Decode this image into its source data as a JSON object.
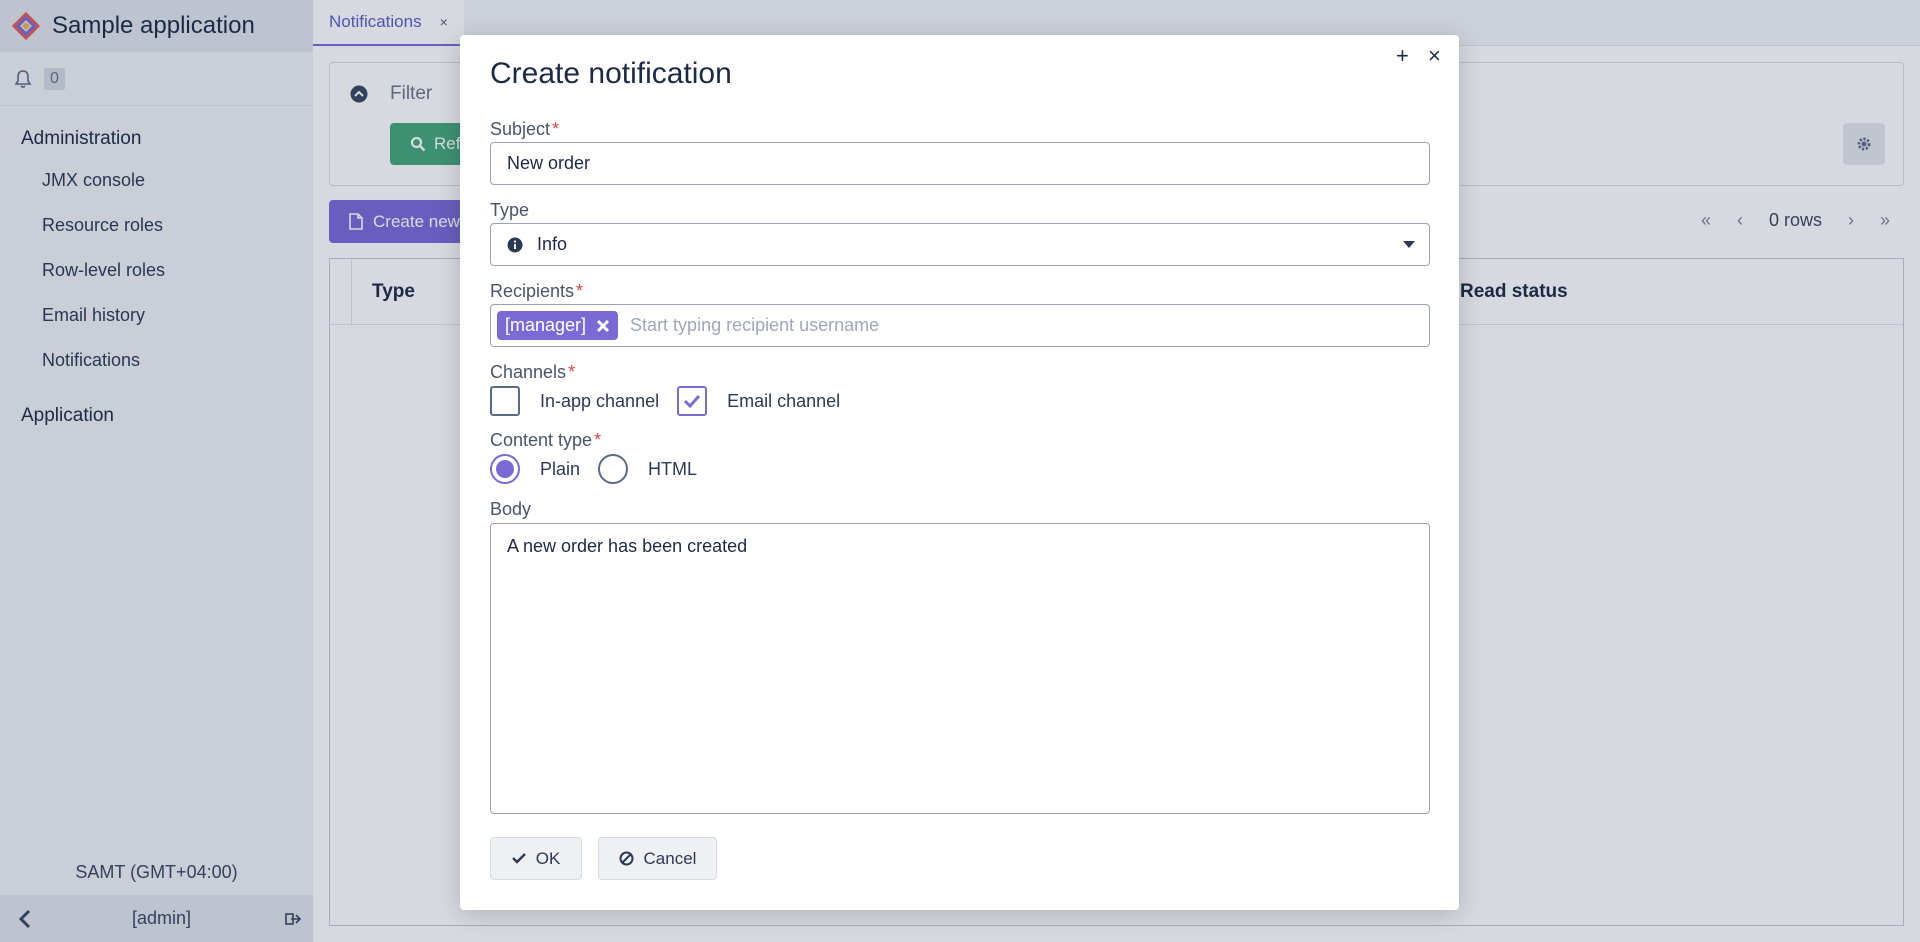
{
  "app": {
    "title": "Sample application",
    "notifications_count": "0",
    "timezone": "SAMT (GMT+04:00)",
    "user": "[admin]"
  },
  "sidebar": {
    "groups": [
      {
        "label": "Administration",
        "items": [
          {
            "label": "JMX console"
          },
          {
            "label": "Resource roles"
          },
          {
            "label": "Row-level roles"
          },
          {
            "label": "Email history"
          },
          {
            "label": "Notifications"
          }
        ]
      },
      {
        "label": "Application",
        "items": []
      }
    ]
  },
  "tabs": [
    {
      "label": "Notifications",
      "close": "×"
    }
  ],
  "filter": {
    "label": "Filter",
    "refresh_label": "Ref"
  },
  "toolbar": {
    "create_label": "Create new"
  },
  "pager": {
    "first": "«",
    "prev": "‹",
    "rows": "0 rows",
    "next": "›",
    "last": "»"
  },
  "grid": {
    "columns": [
      "Type",
      "Read status"
    ]
  },
  "dialog": {
    "title": "Create notification",
    "maximize": "+",
    "close": "×",
    "subject": {
      "label": "Subject",
      "value": "New order"
    },
    "type": {
      "label": "Type",
      "value": "Info"
    },
    "recipients": {
      "label": "Recipients",
      "tokens": [
        "[manager]"
      ],
      "placeholder": "Start typing recipient username"
    },
    "channels": {
      "label": "Channels",
      "options": [
        {
          "label": "In-app channel",
          "checked": false
        },
        {
          "label": "Email channel",
          "checked": true
        }
      ]
    },
    "content_type": {
      "label": "Content type",
      "options": [
        {
          "label": "Plain",
          "selected": true
        },
        {
          "label": "HTML",
          "selected": false
        }
      ]
    },
    "body": {
      "label": "Body",
      "value": "A new order has been created"
    },
    "ok_label": "OK",
    "cancel_label": "Cancel",
    "required_mark": "*"
  },
  "colors": {
    "accent": "#7b6ad6",
    "success": "#44a87b",
    "required": "#e04545"
  }
}
